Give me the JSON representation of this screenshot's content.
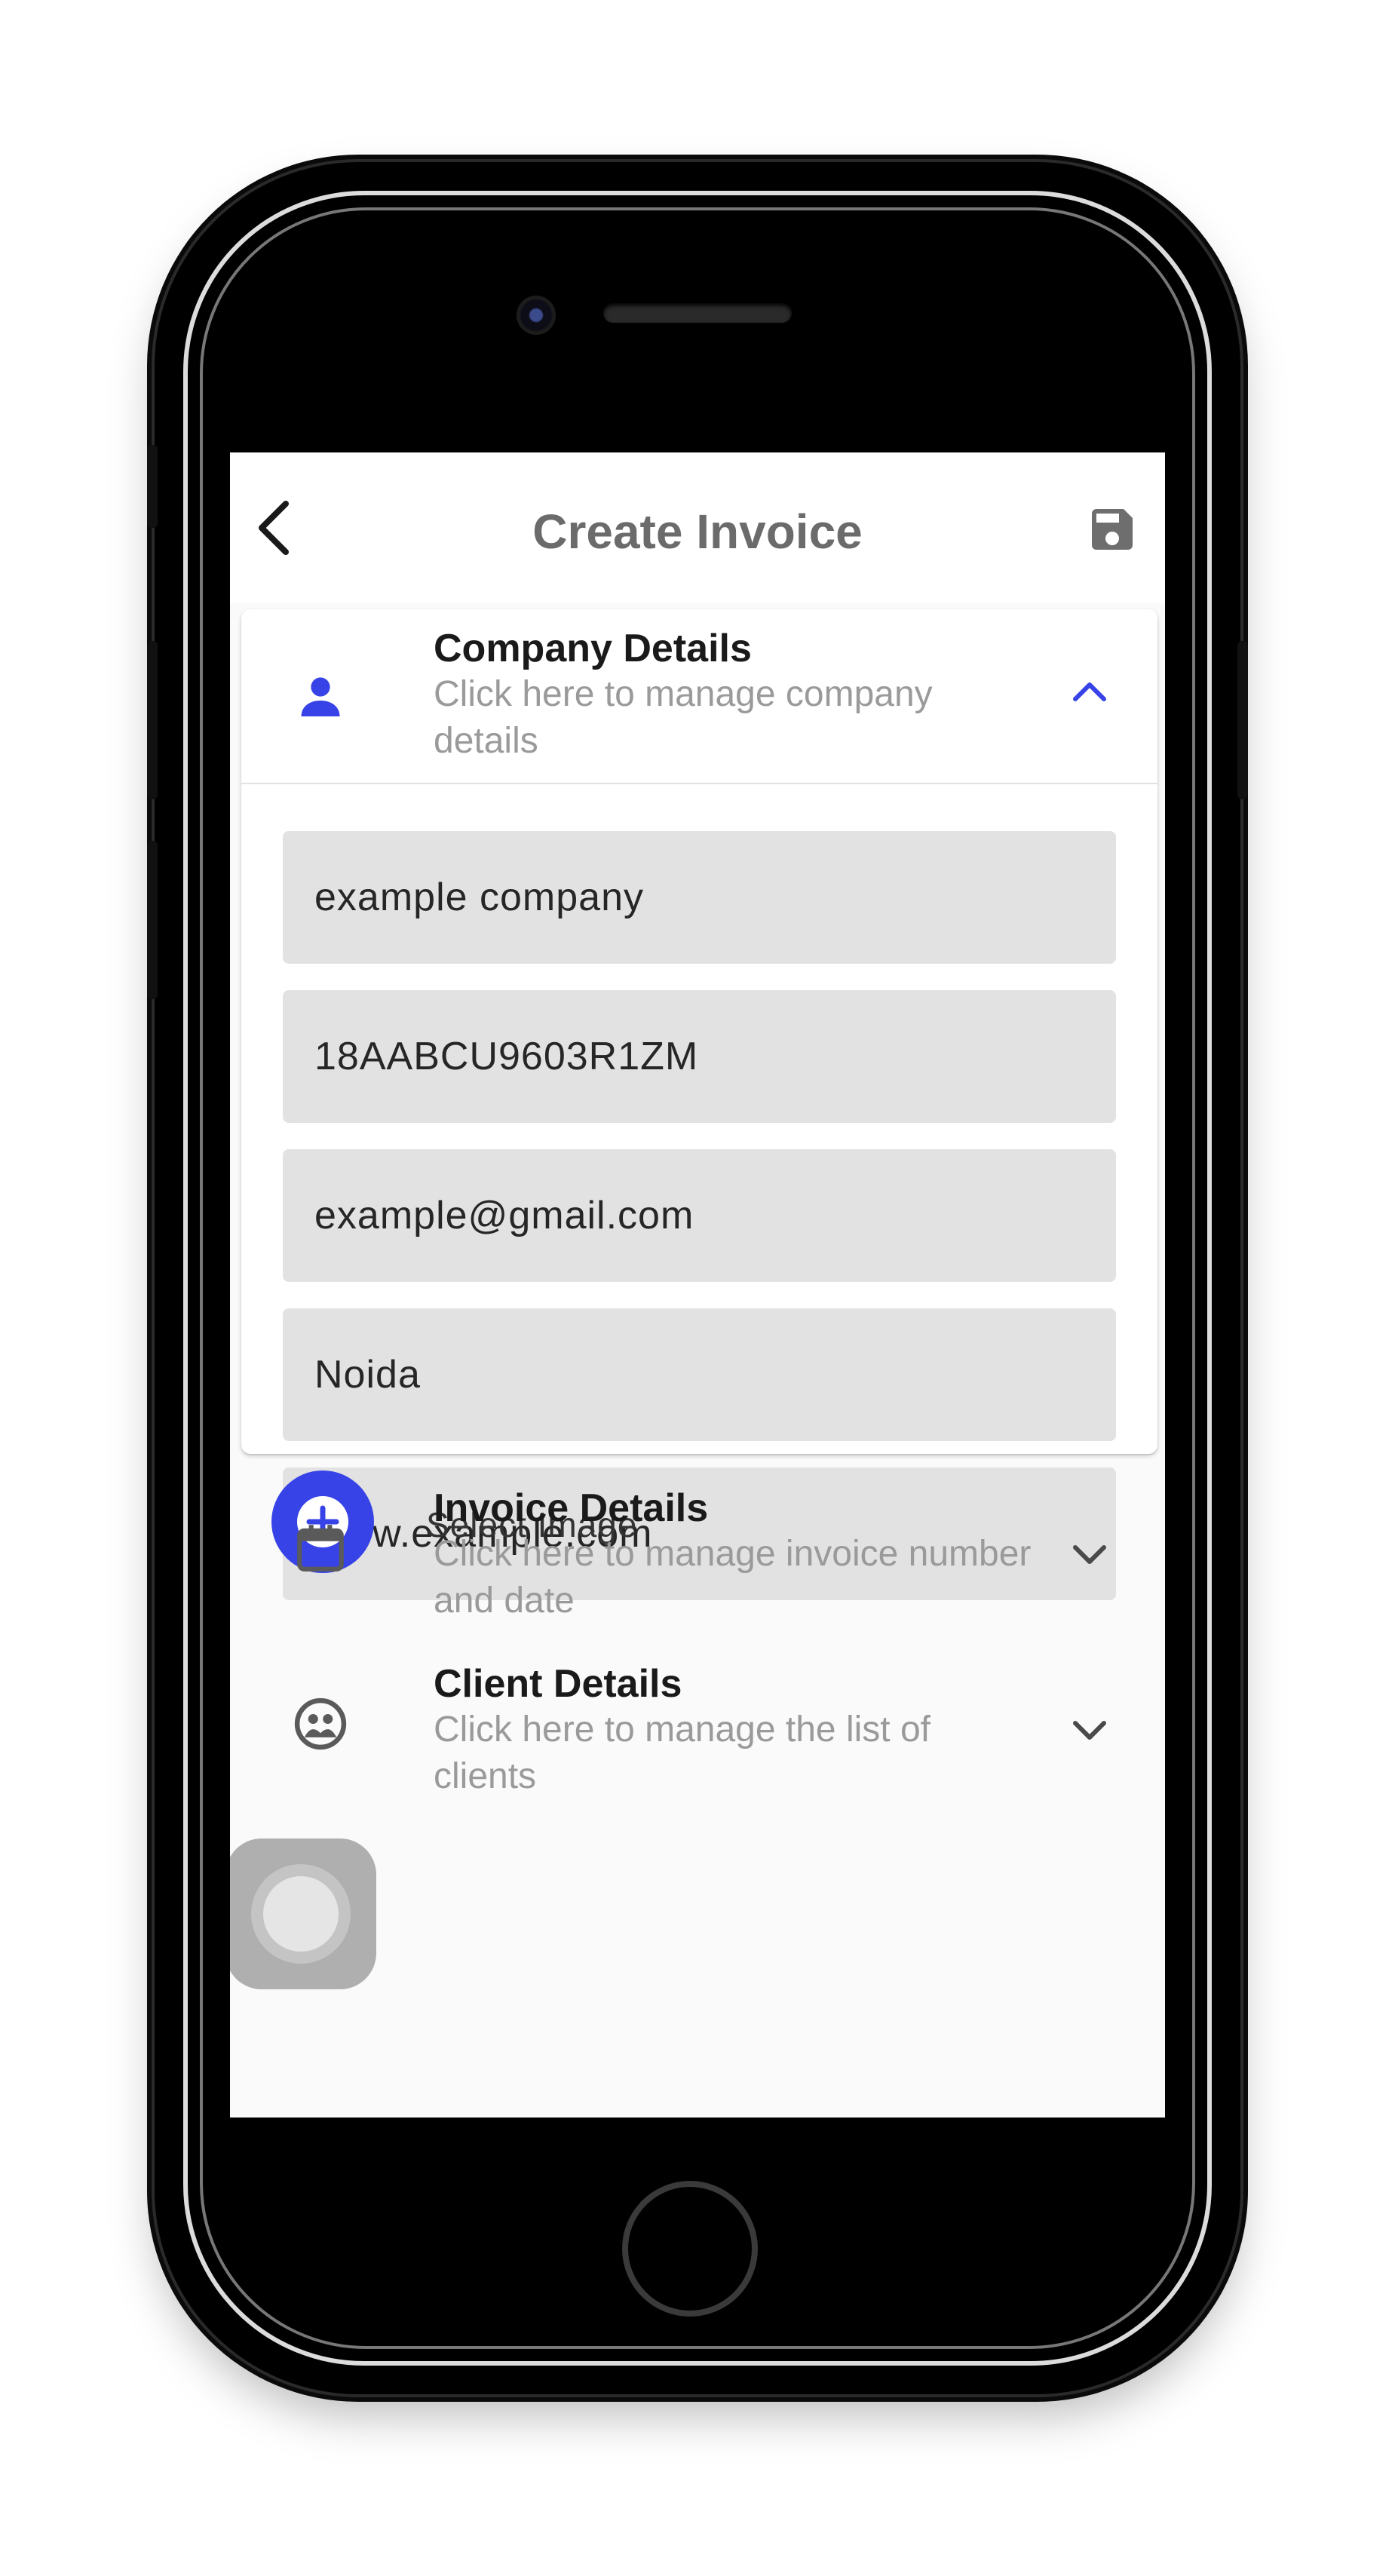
{
  "appbar": {
    "title": "Create Invoice",
    "back_icon": "chevron-left-icon",
    "save_icon": "floppy-disk-icon"
  },
  "company_panel": {
    "title": "Company Details",
    "subtitle": "Click here to manage company details",
    "icon": "person-icon",
    "expanded": true,
    "fields": [
      {
        "value": "example company"
      },
      {
        "value": "18AABCU9603R1ZM"
      },
      {
        "value": "example@gmail.com"
      },
      {
        "value": "Noida"
      },
      {
        "value": "www.example.com"
      }
    ],
    "select_image_label": "Select Image"
  },
  "invoice_panel": {
    "title": "Invoice Details",
    "subtitle": "Click here to manage invoice number and date",
    "icon": "calendar-icon",
    "expanded": false
  },
  "client_panel": {
    "title": "Client Details",
    "subtitle": "Click here to manage the list of clients",
    "icon": "people-circle-icon",
    "expanded": false
  },
  "colors": {
    "accent": "#3743e6",
    "field_bg": "#e2e2e2",
    "title_gray": "#6b6b6b",
    "subtitle_gray": "#9a9a9a"
  }
}
